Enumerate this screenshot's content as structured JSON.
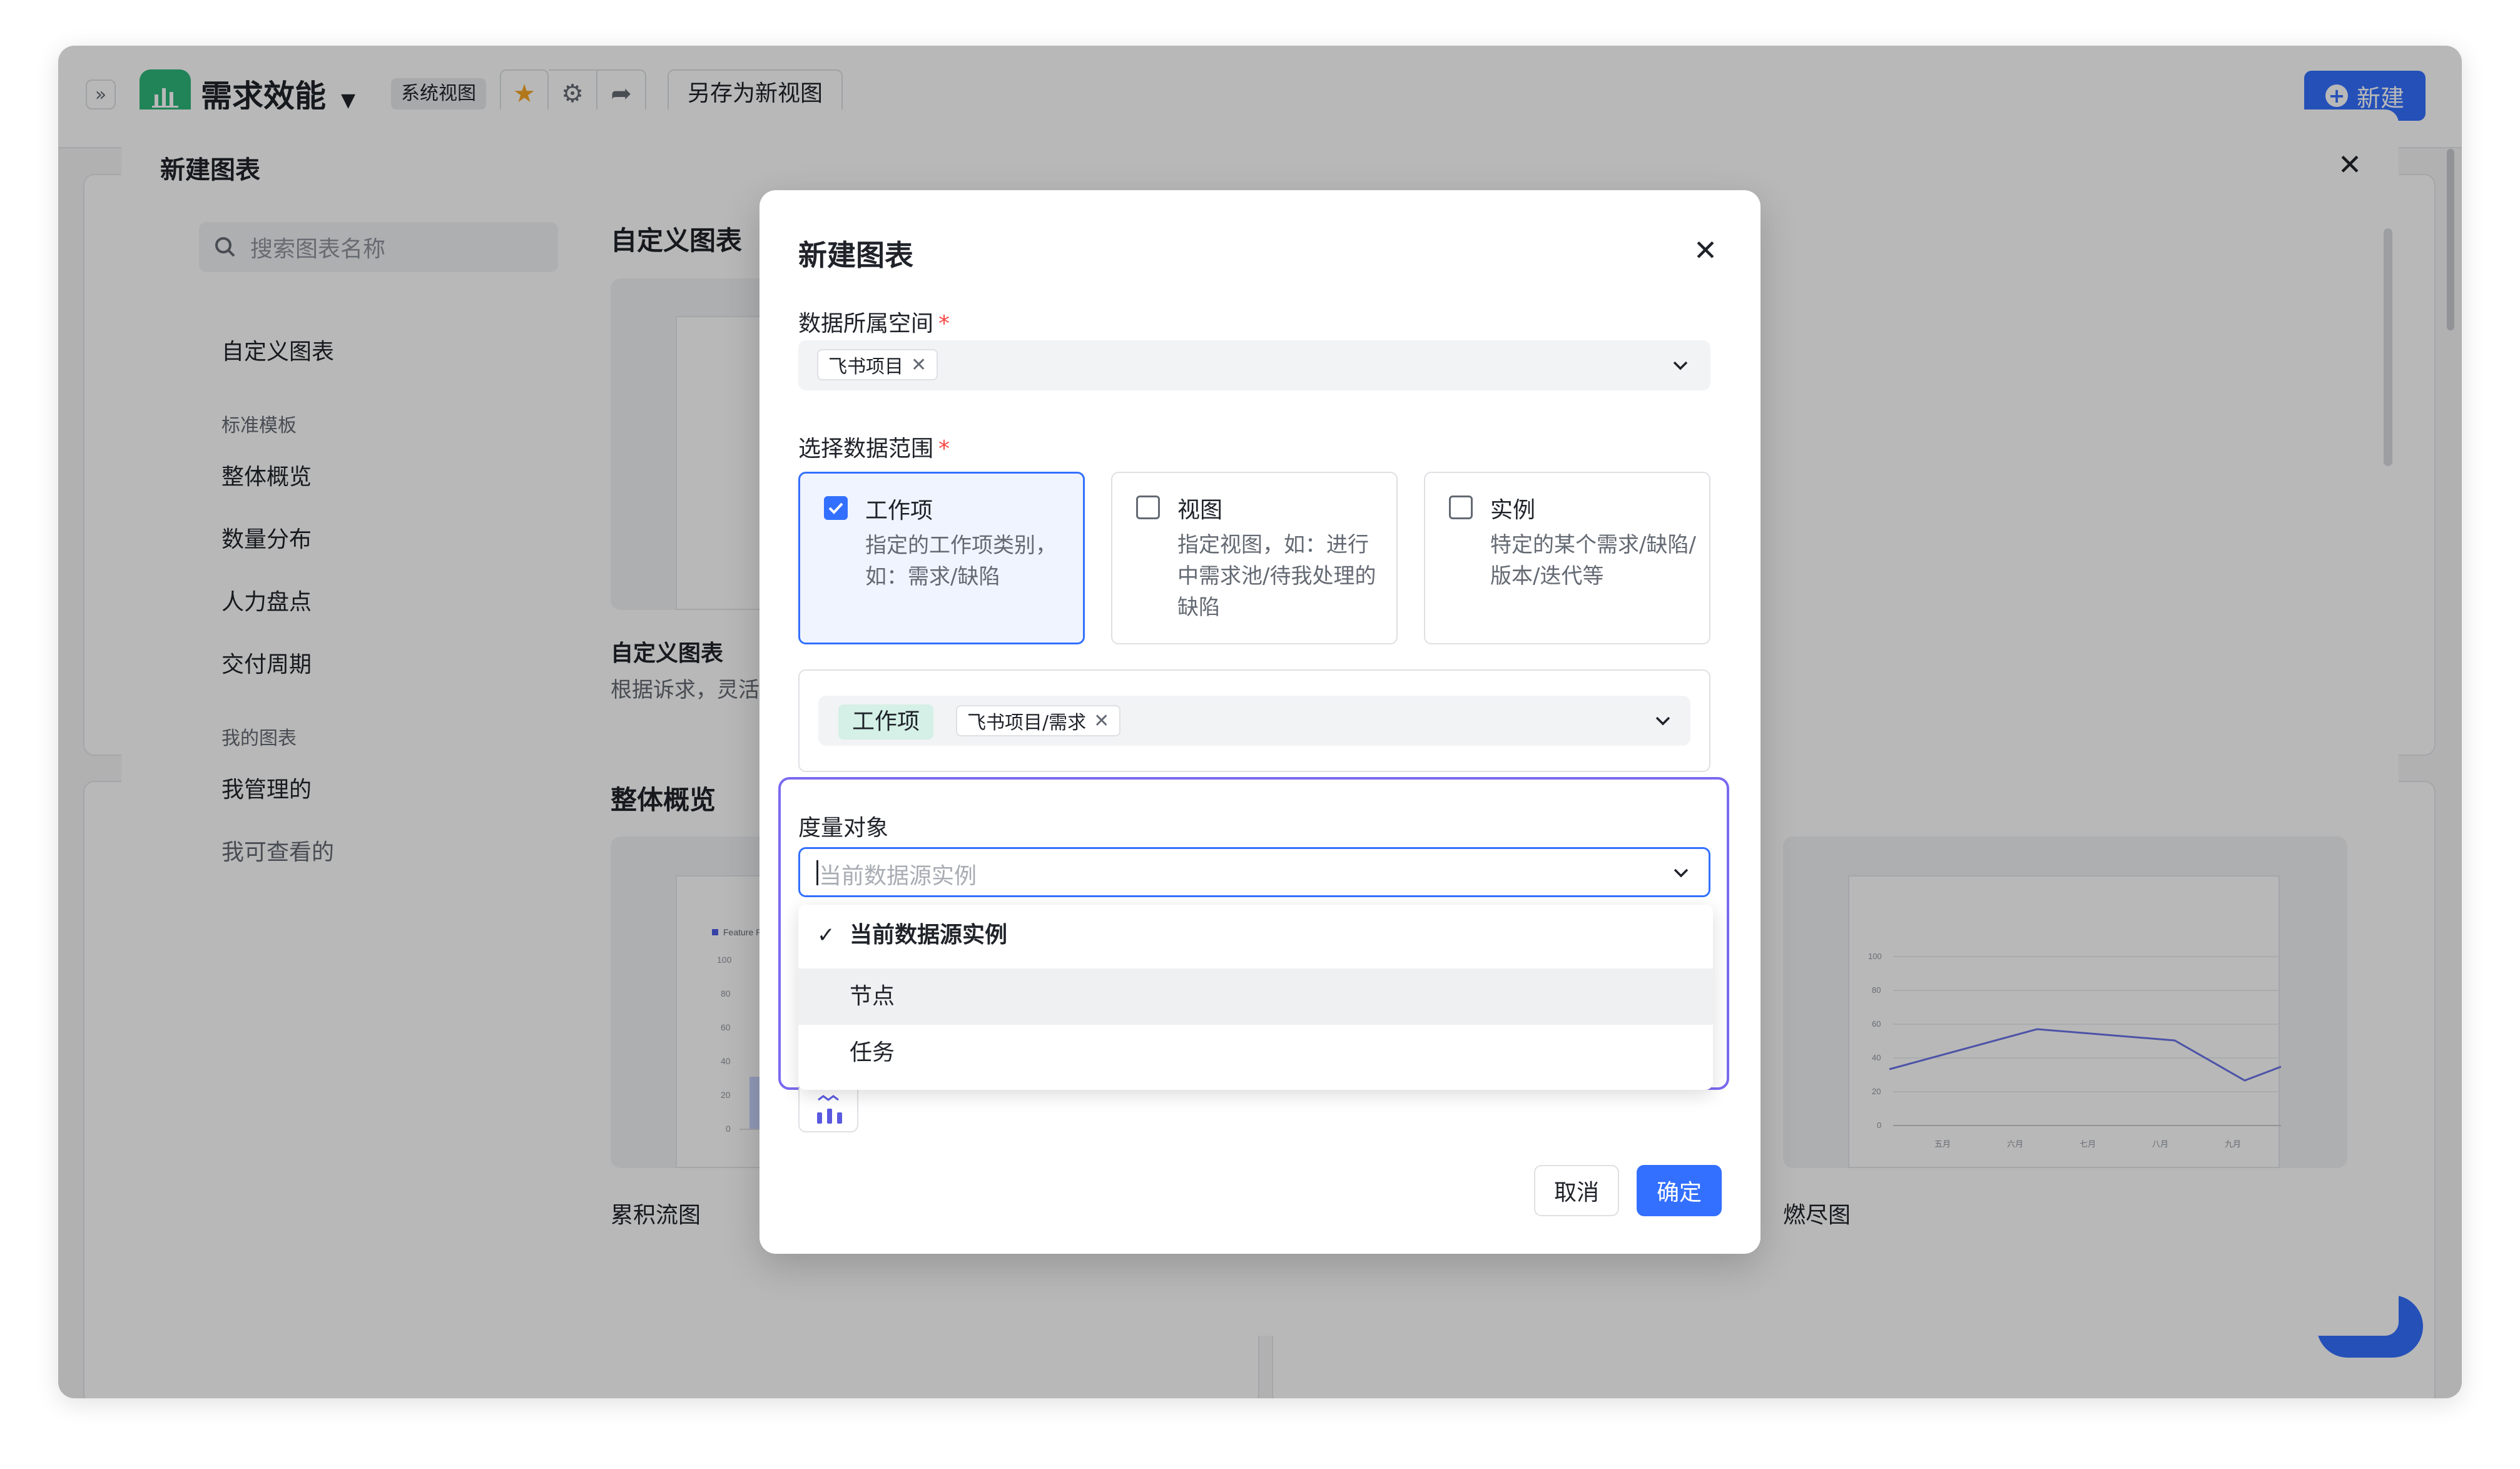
{
  "app": {
    "title": "需求效能",
    "system_view_badge": "系统视图",
    "save_as_label": "另存为新视图",
    "new_label": "新建"
  },
  "gallery": {
    "title": "新建图表",
    "search_placeholder": "搜索图表名称",
    "nav": {
      "custom": "自定义图表",
      "group_standard": "标准模板",
      "overview": "整体概览",
      "distribution": "数量分布",
      "manpower": "人力盘点",
      "delivery": "交付周期",
      "group_mine": "我的图表",
      "managed": "我管理的",
      "viewable": "我可查看的"
    },
    "section_custom": "自定义图表",
    "custom_card": {
      "label": "自定义图表",
      "desc": "根据诉求，灵活"
    },
    "section_overview": "整体概览",
    "card_cfd": {
      "label": "累积流图",
      "legend": "Feature R",
      "ticks": [
        "100",
        "80",
        "60",
        "40",
        "20",
        "0"
      ]
    },
    "card_burndown": {
      "label": "燃尽图",
      "yticks": [
        "100",
        "80",
        "60",
        "40",
        "20",
        "0"
      ],
      "xticks": [
        "五月",
        "六月",
        "七月",
        "八月",
        "九月"
      ]
    }
  },
  "dialog": {
    "title": "新建图表",
    "space_label": "数据所属空间",
    "required_mark": "*",
    "space_tag": "飞书项目",
    "range_label": "选择数据范围",
    "range_options": [
      {
        "title": "工作项",
        "desc": "指定的工作项类别，如：需求/缺陷",
        "checked": true
      },
      {
        "title": "视图",
        "desc": "指定视图，如：进行中需求池/待我处理的缺陷",
        "checked": false
      },
      {
        "title": "实例",
        "desc": "特定的某个需求/缺陷/版本/迭代等",
        "checked": false
      }
    ],
    "scope_chip": "工作项",
    "scope_tag": "飞书项目/需求",
    "measure_label": "度量对象",
    "measure_placeholder": "当前数据源实例",
    "measure_options": [
      {
        "label": "当前数据源实例",
        "selected": true
      },
      {
        "label": "节点",
        "selected": false
      },
      {
        "label": "任务",
        "selected": false
      }
    ],
    "cancel_label": "取消",
    "ok_label": "确定"
  },
  "colors": {
    "primary": "#3370ff",
    "focus_frame": "#7a6af0",
    "logo_green": "#2fb67a",
    "chip_green": "#d5f0e6",
    "required_red": "#f54a45"
  }
}
